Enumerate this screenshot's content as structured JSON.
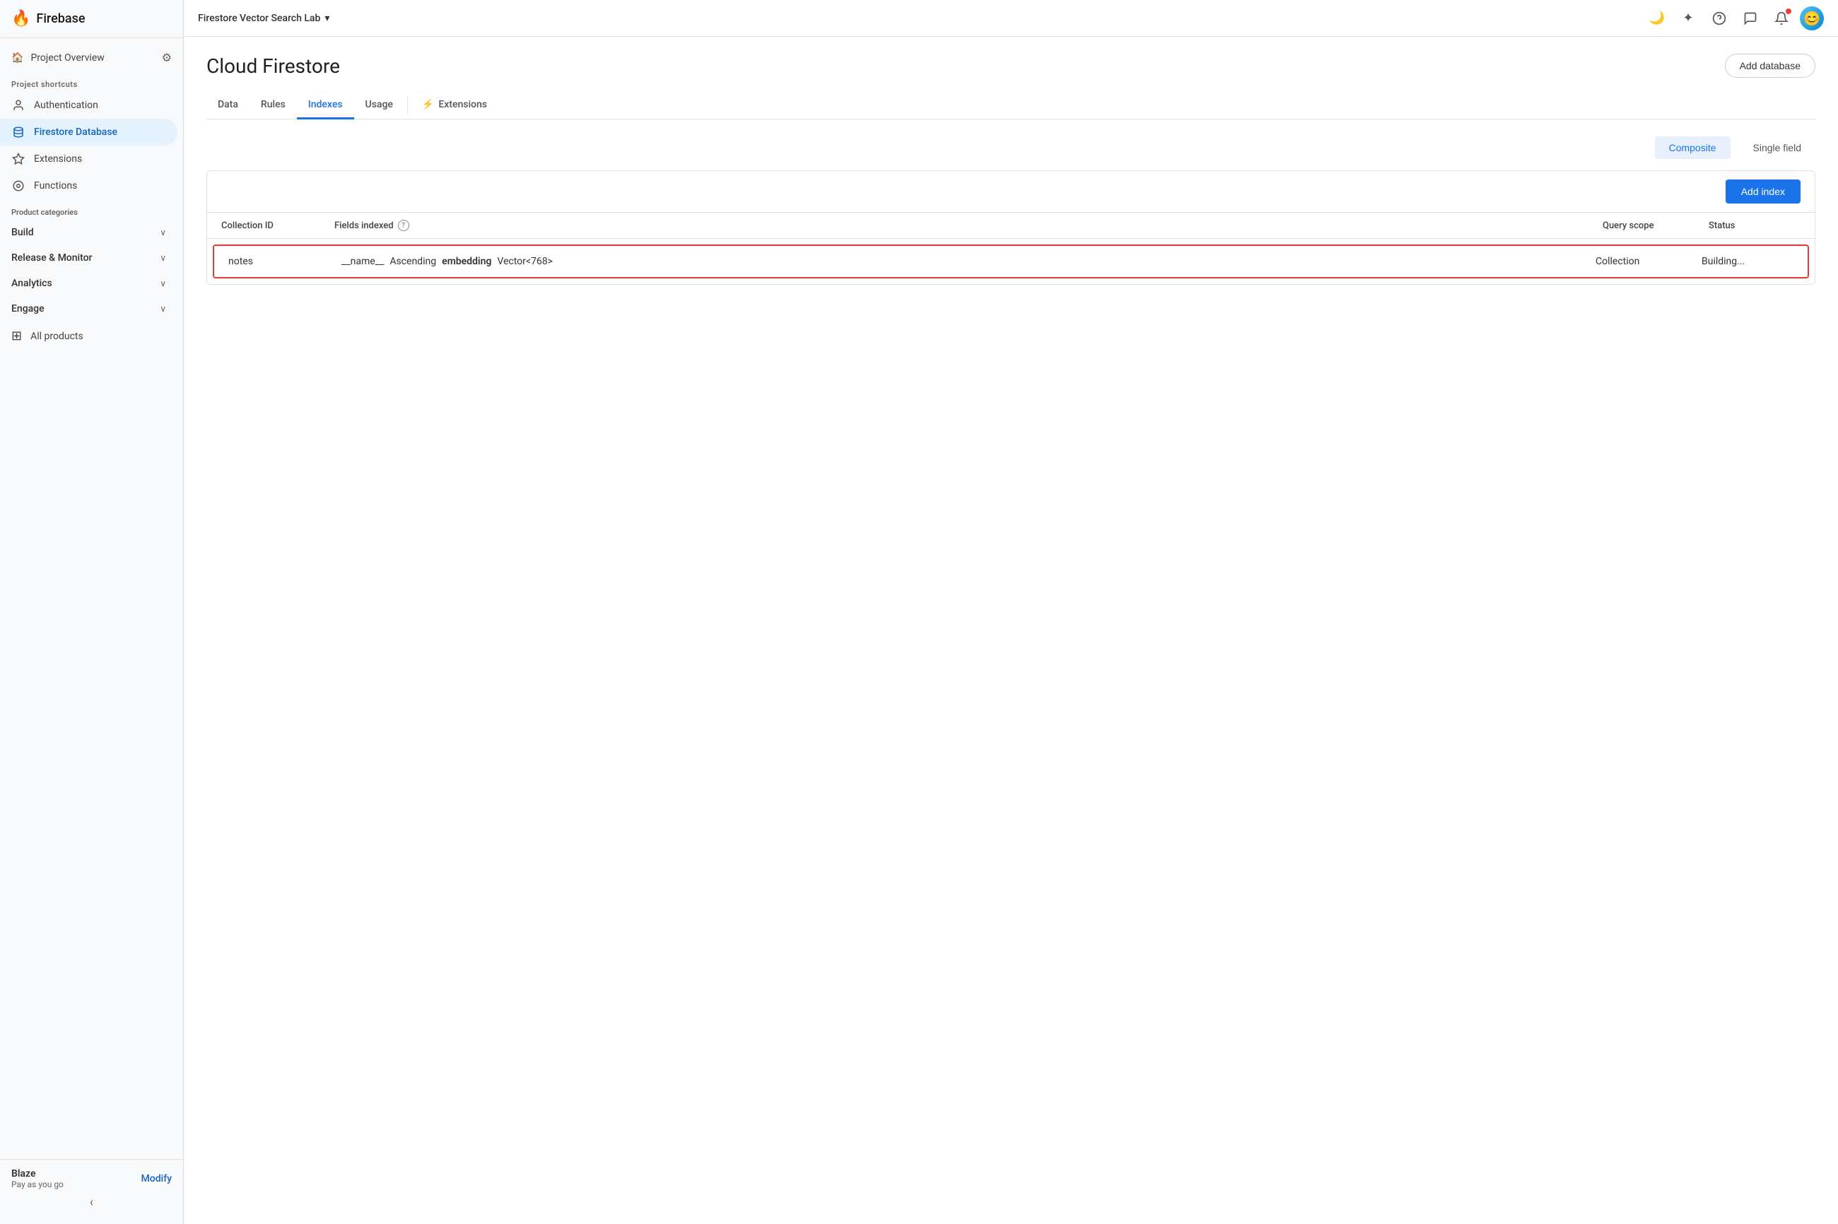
{
  "sidebar": {
    "logo_text": "Firebase",
    "project_overview_label": "Project Overview",
    "settings_icon": "⚙",
    "sections": {
      "project_shortcuts_label": "Project shortcuts",
      "product_categories_label": "Product categories"
    },
    "nav_items": [
      {
        "id": "authentication",
        "label": "Authentication",
        "icon": "👤"
      },
      {
        "id": "firestore",
        "label": "Firestore Database",
        "icon": "~",
        "active": true
      },
      {
        "id": "extensions",
        "label": "Extensions",
        "icon": "✦"
      },
      {
        "id": "functions",
        "label": "Functions",
        "icon": "⊙"
      }
    ],
    "collapsible": [
      {
        "id": "build",
        "label": "Build"
      },
      {
        "id": "release-monitor",
        "label": "Release & Monitor"
      },
      {
        "id": "analytics",
        "label": "Analytics"
      },
      {
        "id": "engage",
        "label": "Engage"
      }
    ],
    "all_products_label": "All products",
    "footer": {
      "plan_name": "Blaze",
      "plan_sub": "Pay as you go",
      "modify_label": "Modify"
    },
    "collapse_arrow": "‹"
  },
  "topbar": {
    "project_selector": "Firestore Vector Search Lab",
    "dropdown_icon": "▾",
    "icons": {
      "moon": "🌙",
      "sparkle": "✦",
      "help": "?",
      "chat": "💬",
      "bell": "🔔"
    }
  },
  "page": {
    "title": "Cloud Firestore",
    "add_database_label": "Add database",
    "tabs": [
      {
        "id": "data",
        "label": "Data",
        "active": false
      },
      {
        "id": "rules",
        "label": "Rules",
        "active": false
      },
      {
        "id": "indexes",
        "label": "Indexes",
        "active": true
      },
      {
        "id": "usage",
        "label": "Usage",
        "active": false
      },
      {
        "id": "extensions",
        "label": "Extensions",
        "active": false,
        "has_icon": true
      }
    ],
    "index_view": {
      "composite_label": "Composite",
      "single_field_label": "Single field",
      "add_index_label": "Add index",
      "columns": {
        "collection_id": "Collection ID",
        "fields_indexed": "Fields indexed",
        "query_scope": "Query scope",
        "status": "Status"
      },
      "rows": [
        {
          "collection_id": "notes",
          "fields": "__name__ Ascending  embedding Vector<768>",
          "field_parts": [
            {
              "text": "__name__",
              "bold": false
            },
            {
              "text": "Ascending",
              "bold": false
            },
            {
              "text": "embedding",
              "bold": true
            },
            {
              "text": "Vector<768>",
              "bold": false
            }
          ],
          "query_scope": "Collection",
          "status": "Building...",
          "highlighted": true
        }
      ]
    }
  }
}
